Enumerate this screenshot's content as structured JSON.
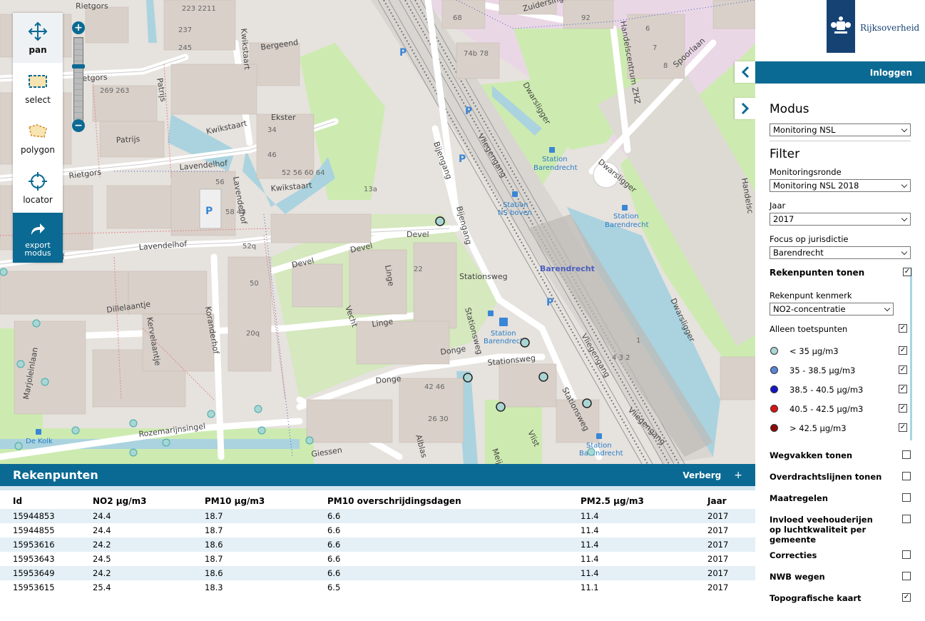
{
  "brand": {
    "name": "Rijksoverheid",
    "login_label": "Inloggen"
  },
  "toolbar": {
    "pan": "pan",
    "select": "select",
    "polygon": "polygon",
    "locator": "locator",
    "export_line1": "export",
    "export_line2": "modus"
  },
  "zoom": {
    "in": "+",
    "out": "−"
  },
  "map": {
    "streets": [
      "Rietgors",
      "Kwikstaart",
      "Bergeend",
      "Patrijs",
      "Ekster",
      "Lavendelhof",
      "Devel",
      "Linge",
      "Stationsweg",
      "Donge",
      "Vecht",
      "Koranderhof",
      "Kervelaantje",
      "Dillelaantje",
      "Rozemarijnsingel",
      "Giessen",
      "Alblas",
      "Vlist",
      "Vliegengang",
      "Bijengang",
      "Dwarsligger",
      "Spoorlaan",
      "Handelscentrum ZHZ",
      "Zuidersingel",
      "Marjoleinlaan",
      "Handelsc",
      "Meije",
      "semhof"
    ],
    "places": [
      "Station Barendrecht",
      "Station NS boven",
      "Barendrecht",
      "De Kolk"
    ]
  },
  "bottom": {
    "title": "Rekenpunten",
    "hide_label": "Verberg",
    "plus": "+",
    "columns": [
      "Id",
      "NO2 µg/m3",
      "PM10 µg/m3",
      "PM10 overschrijdingsdagen",
      "PM2.5 µg/m3",
      "Jaar"
    ],
    "rows": [
      [
        "15944853",
        "24.4",
        "18.7",
        "6.6",
        "11.4",
        "2017"
      ],
      [
        "15944855",
        "24.4",
        "18.7",
        "6.6",
        "11.4",
        "2017"
      ],
      [
        "15953616",
        "24.2",
        "18.6",
        "6.6",
        "11.4",
        "2017"
      ],
      [
        "15953643",
        "24.5",
        "18.7",
        "6.6",
        "11.4",
        "2017"
      ],
      [
        "15953649",
        "24.2",
        "18.6",
        "6.6",
        "11.4",
        "2017"
      ],
      [
        "15953615",
        "25.4",
        "18.3",
        "6.5",
        "11.1",
        "2017"
      ]
    ]
  },
  "sidebar": {
    "modus_title": "Modus",
    "modus_value": "Monitoring NSL",
    "filter_title": "Filter",
    "monitoringsronde_label": "Monitoringsronde",
    "monitoringsronde_value": "Monitoring NSL 2018",
    "jaar_label": "Jaar",
    "jaar_value": "2017",
    "focus_label": "Focus op jurisdictie",
    "focus_value": "Barendrecht",
    "rekenpunten_label": "Rekenpunten tonen",
    "kenmerk_label": "Rekenpunt kenmerk",
    "kenmerk_value": "NO2-concentratie",
    "toetspunten_label": "Alleen toetspunten",
    "legend": [
      {
        "label": "< 35 µg/m3",
        "color": "#a9d6d3"
      },
      {
        "label": "35 - 38.5 µg/m3",
        "color": "#5b86d6"
      },
      {
        "label": "38.5 - 40.5 µg/m3",
        "color": "#1515c8"
      },
      {
        "label": "40.5 - 42.5 µg/m3",
        "color": "#d81414"
      },
      {
        "label": "> 42.5 µg/m3",
        "color": "#8c0a0a"
      }
    ],
    "layers": [
      {
        "label": "Wegvakken tonen",
        "checked": false
      },
      {
        "label": "Overdrachtslijnen tonen",
        "checked": false
      },
      {
        "label": "Maatregelen",
        "checked": false
      },
      {
        "label": "Invloed veehouderijen op luchtkwaliteit per gemeente",
        "checked": false
      },
      {
        "label": "Correcties",
        "checked": false
      },
      {
        "label": "NWB wegen",
        "checked": false
      },
      {
        "label": "Topografische kaart",
        "checked": true
      }
    ],
    "check_mark": "✓"
  },
  "colors": {
    "accent": "#0b6a93",
    "brand": "#154273"
  }
}
